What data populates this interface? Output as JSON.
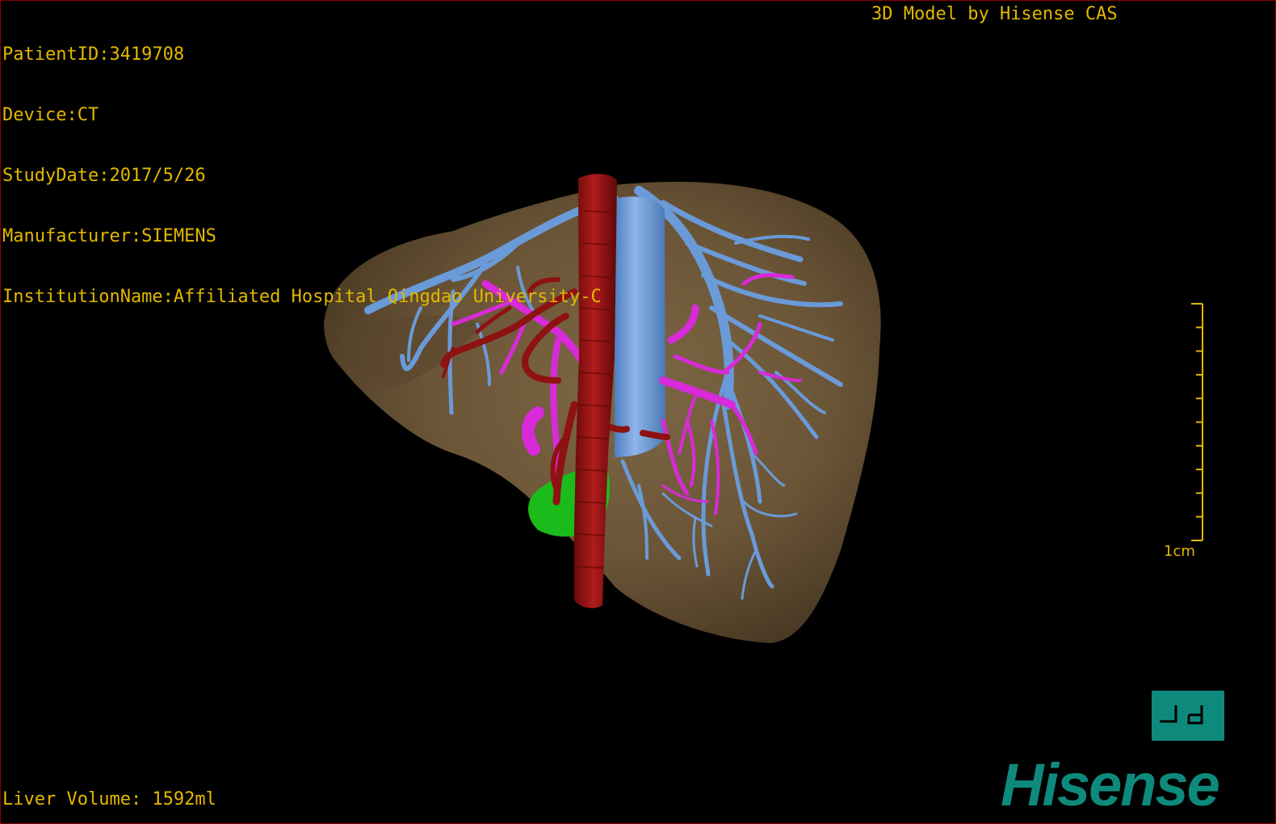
{
  "patient_info": {
    "patient_id": "PatientID:3419708",
    "device": "Device:CT",
    "study_date": "StudyDate:2017/5/26",
    "manufacturer": "Manufacturer:SIEMENS",
    "institution": "InstitutionName:Affiliated Hospital Qingdao University-C"
  },
  "model_credit": "3D Model by Hisense CAS",
  "liver_volume": "Liver Volume: 1592ml",
  "scale_bar": {
    "label": "1cm",
    "ticks": 10
  },
  "logo": {
    "text": "Hisense",
    "color": "#0e8a7c"
  },
  "colors": {
    "overlay_text": "#e3b800",
    "liver": "#6b5537",
    "hepatic_vein": "#5f8fd0",
    "portal_vein": "#d82ad8",
    "artery": "#8e1212",
    "gallbladder": "#18b818",
    "viewport_border": "#8a0000",
    "orientation_cube": "#0e8a7c"
  },
  "icons": {
    "orientation": "orientation-cube-icon"
  }
}
